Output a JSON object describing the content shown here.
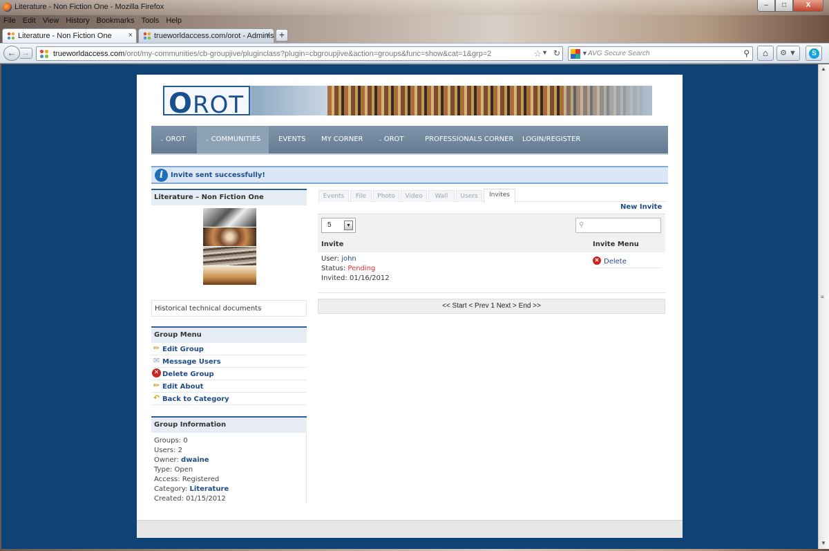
{
  "window": {
    "title": "Literature - Non Fiction One - Mozilla Firefox",
    "buttons": {
      "minimize": "–",
      "maximize": "□",
      "close": "X"
    }
  },
  "menubar": [
    "File",
    "Edit",
    "View",
    "History",
    "Bookmarks",
    "Tools",
    "Help"
  ],
  "tabs": [
    {
      "label": "Literature - Non Fiction One",
      "active": true,
      "close": "×"
    },
    {
      "label": "trueworldaccess.com/orot - Administ...",
      "active": false,
      "close": "×"
    }
  ],
  "newtab_label": "+",
  "navbar": {
    "url_domain": "trueworldaccess.com",
    "url_path": "/orot/my-communities/cb-groupjive/pluginclass?plugin=cbgroupjive&action=groups&func=show&cat=1&grp=2",
    "search_placeholder": "AVG Secure Search"
  },
  "site": {
    "logo_text": "ROT",
    "logo_initial": "O",
    "nav": [
      "OROT",
      "COMMUNITIES",
      "EVENTS",
      "MY CORNER",
      "OROT",
      "PROFESSIONALS CORNER",
      "LOGIN/REGISTER"
    ],
    "alert": "Invite sent successfully!"
  },
  "sidebar": {
    "group_title": "Literature – Non Fiction One",
    "description": "Historical technical documents",
    "menu_title": "Group Menu",
    "menu_items": [
      "Edit Group",
      "Message Users",
      "Delete Group",
      "Edit About",
      "Back to Category"
    ],
    "info_title": "Group Information",
    "info": {
      "groups_label": "Groups:",
      "groups": "0",
      "users_label": "Users:",
      "users": "2",
      "owner_label": "Owner:",
      "owner": "dwaine",
      "type_label": "Type:",
      "type": "Open",
      "access_label": "Access:",
      "access": "Registered",
      "category_label": "Category:",
      "category": "Literature",
      "created_label": "Created:",
      "created": "01/15/2012"
    }
  },
  "content": {
    "tabs": [
      "Events",
      "File",
      "Photo",
      "Video",
      "Wall",
      "Users",
      "Invites"
    ],
    "new_invite": "New Invite",
    "page_size": "5",
    "col_invite": "Invite",
    "col_menu": "Invite Menu",
    "invite": {
      "user_label": "User:",
      "user": "john",
      "status_label": "Status:",
      "status": "Pending",
      "invited_label": "Invited:",
      "invited": "01/16/2012",
      "delete": "Delete"
    },
    "pager": "<< Start < Prev 1 Next > End >>"
  }
}
